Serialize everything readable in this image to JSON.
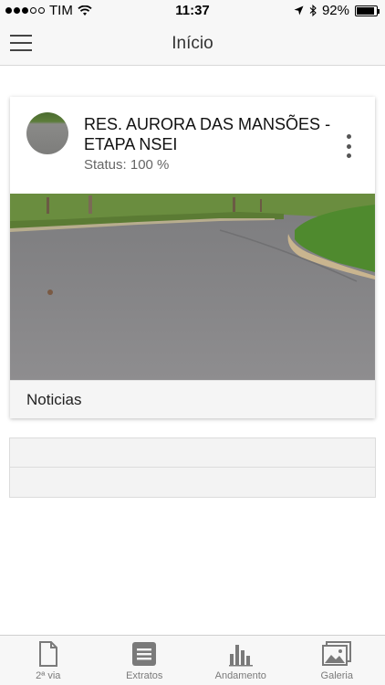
{
  "status_bar": {
    "carrier": "TIM",
    "time": "11:37",
    "battery": "92%",
    "battery_level": 0.92
  },
  "nav": {
    "title": "Início"
  },
  "card": {
    "title": "RES. AURORA DAS MANSÕES - ETAPA NSEI",
    "status": "Status: 100 %",
    "footer_label": "Noticias"
  },
  "tabs": [
    {
      "label": "2ª via",
      "icon": "document-icon"
    },
    {
      "label": "Extratos",
      "icon": "extract-icon"
    },
    {
      "label": "Andamento",
      "icon": "bar-chart-icon"
    },
    {
      "label": "Galeria",
      "icon": "gallery-icon"
    }
  ],
  "colors": {
    "tab_icon": "#7a7a7a",
    "bar_background": "#f7f7f7"
  }
}
